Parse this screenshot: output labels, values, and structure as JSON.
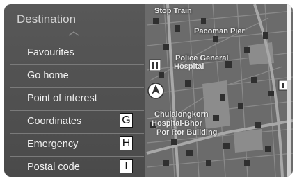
{
  "panel": {
    "title": "Destination",
    "items": [
      {
        "label": "Favourites"
      },
      {
        "label": "Go home"
      },
      {
        "label": "Point of interest"
      },
      {
        "label": "Coordinates",
        "badge": "G"
      },
      {
        "label": "Emergency",
        "badge": "H"
      },
      {
        "label": "Postal code",
        "badge": "I"
      }
    ]
  },
  "map": {
    "labels": [
      "Stop Train",
      "Pacoman Pier",
      "Police General",
      "Hospital",
      "Chulalongkorn",
      "Hospital-Bhor",
      "Por Ror Building"
    ]
  },
  "colors": {
    "panel_bg": "#525252",
    "map_road": "#9a9a9a",
    "map_bg": "#6e6e6e",
    "accent_line": "#b0b0b0"
  }
}
